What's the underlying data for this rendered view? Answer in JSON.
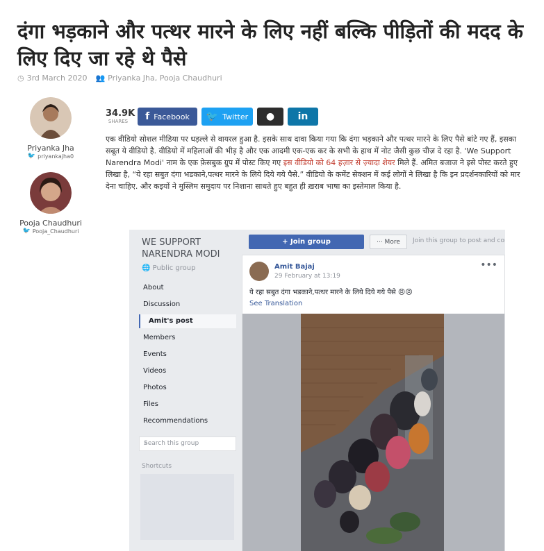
{
  "article": {
    "headline": "दंगा भड़काने और पत्थर मारने के लिए नहीं बल्कि पीड़ितों की मदद के लिए दिए जा रहे थे पैसे",
    "date": "3rd March 2020",
    "authors_line": "Priyanka Jha, Pooja Chaudhuri",
    "body_part1": "एक वीडियो सोशल मीडिया पर धड़ल्ले से वायरल हुआ है. इसके साथ दावा किया गया कि दंगा भड़काने और पत्थर मारने के लिए पैसे बांटे गए हैं, इसका सबूत ये वीडियो है. वीडियो में महिलाओं की भीड़ है और एक आदमी एक-एक कर के सभी के हाथ में नोट जैसी कुछ चीज़ दे रहा है. 'We Support Narendra Modi' नाम के एक फ़ेसबुक ग्रुप में पोस्ट किए गए ",
    "body_link": "इस वीडियो को 64 हज़ार से ज़्यादा शेयर",
    "body_part2": " मिले हैं. अमित बजाज ने इसे पोस्ट करते हुए लिखा है, “ये रहा सबुत दंगा भडकाने,पत्थर मारने के लिये दिये गये पैसे.” वीडियो के कमेंट सेक्शन में कई लोगों ने लिखा है कि इन प्रदर्शनकारियों को मार देना चाहिए. और कइयों ने मुस्लिम समुदाय पर निशाना साधते हुए बहुत ही ख़राब भाषा का इस्तेमाल किया है."
  },
  "authors": [
    {
      "name": "Priyanka Jha",
      "handle": "priyankajha0"
    },
    {
      "name": "Pooja Chaudhuri",
      "handle": "Pooja_Chaudhuri"
    }
  ],
  "share": {
    "count": "34.9K",
    "count_label": "SHARES",
    "facebook": "Facebook",
    "twitter": "Twitter"
  },
  "screenshot": {
    "group_title": "WE SUPPORT NARENDRA MODI",
    "group_type": "Public group",
    "nav": [
      "About",
      "Discussion",
      "Amit's post",
      "Members",
      "Events",
      "Videos",
      "Photos",
      "Files",
      "Recommendations"
    ],
    "search_placeholder": "Search this group",
    "shortcuts": "Shortcuts",
    "join_button": "+ Join group",
    "more_button": "··· More",
    "join_text": "Join this group to post and comme",
    "post_author": "Amit Bajaj",
    "post_time": "29 February at 13:19",
    "post_text": "ये रहा सबुत दंगा भडकाने,पत्थर मारने के लिये दिये गये पैसे 😠😠",
    "see_translation": "See Translation"
  },
  "colors": {
    "facebook": "#3b5998",
    "twitter": "#1da1f2",
    "reddit": "#2d2d2d",
    "linkedin": "#0e76a8",
    "link_red": "#c0392b"
  }
}
